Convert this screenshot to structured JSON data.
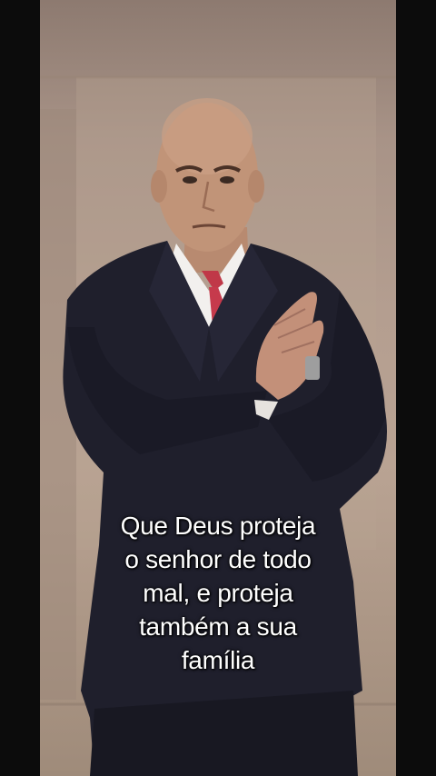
{
  "caption": {
    "lines": [
      "Que Deus proteja",
      "o senhor de todo",
      "mal, e proteja",
      "também a sua",
      "família"
    ]
  }
}
